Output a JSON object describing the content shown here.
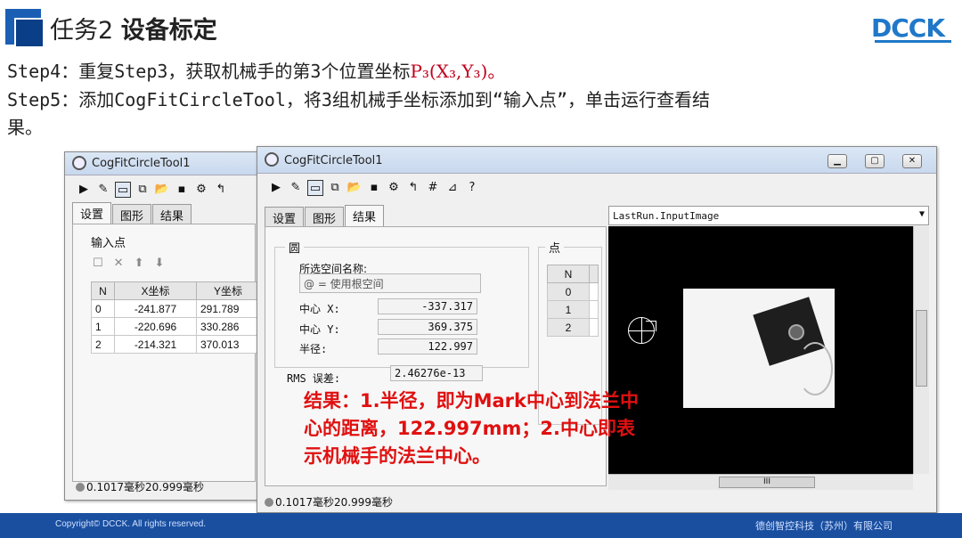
{
  "slide": {
    "title_prefix": "任务2 ",
    "title_bold": "设备标定",
    "logo": "DCCK",
    "step4_prefix": "Step4：重复Step3，获取机械手的第3个位置坐标",
    "step4_red": "P₃(X₃,Y₃)。",
    "step5_line1": "Step5：添加CogFitCircleTool，将3组机械手坐标添加到“输入点”，单击运行查看结",
    "step5_line2": "果。",
    "footer_left": "Copyright© DCCK. All rights reserved.",
    "footer_right": "德创智控科技（苏州）有限公司"
  },
  "back_window": {
    "title": "CogFitCircleTool1",
    "tabs": [
      "设置",
      "图形",
      "结果"
    ],
    "section_label": "输入点",
    "table": {
      "headers": [
        "N",
        "X坐标",
        "Y坐标"
      ],
      "rows": [
        [
          "0",
          "-241.877",
          "291.789"
        ],
        [
          "1",
          "-220.696",
          "330.286"
        ],
        [
          "2",
          "-214.321",
          "370.013"
        ]
      ]
    },
    "status_text": "0.1017毫秒20.999毫秒"
  },
  "front_window": {
    "title": "CogFitCircleTool1",
    "tabs": [
      "设置",
      "图形",
      "结果"
    ],
    "circle_group": "圆",
    "space_label": "所选空间名称:",
    "space_value": "@ = 使用根空间",
    "center_x_label": "中心 X:",
    "center_x_value": "-337.317",
    "center_y_label": "中心 Y:",
    "center_y_value": "369.375",
    "radius_label": "半径:",
    "radius_value": "122.997",
    "rms_label": "RMS 误差:",
    "rms_value": "2.46276e-13",
    "points_group": "点",
    "points_header": "N",
    "points_rows": [
      "0",
      "1",
      "2"
    ],
    "image_selector": "LastRun.InputImage",
    "scroll_thumb": "III",
    "status_text": "0.1017毫秒20.999毫秒",
    "annotation_line1": "结果：1.半径，即为Mark中心到法兰中",
    "annotation_line2": "心的距离，122.997mm；2.中心即表",
    "annotation_line3": "示机械手的法兰中心。"
  },
  "colors": {
    "accent_blue": "#1a5fb4",
    "footer_blue": "#1a4fa0",
    "highlight_red": "#c0001d",
    "annotation_red": "#e01010"
  }
}
